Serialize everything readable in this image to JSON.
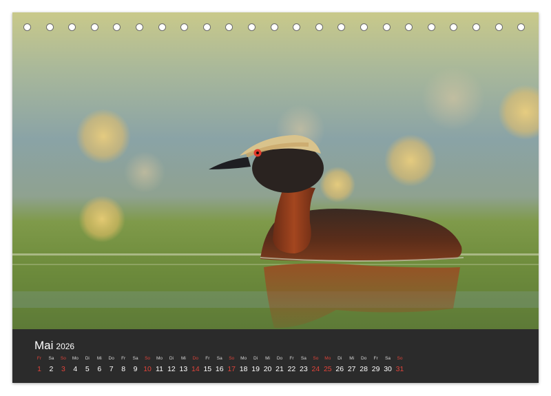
{
  "calendar": {
    "month": "Mai",
    "year": "2026",
    "days": [
      {
        "wd": "Fr",
        "n": "1",
        "red": true
      },
      {
        "wd": "Sa",
        "n": "2",
        "red": false
      },
      {
        "wd": "So",
        "n": "3",
        "red": true
      },
      {
        "wd": "Mo",
        "n": "4",
        "red": false
      },
      {
        "wd": "Di",
        "n": "5",
        "red": false
      },
      {
        "wd": "Mi",
        "n": "6",
        "red": false
      },
      {
        "wd": "Do",
        "n": "7",
        "red": false
      },
      {
        "wd": "Fr",
        "n": "8",
        "red": false
      },
      {
        "wd": "Sa",
        "n": "9",
        "red": false
      },
      {
        "wd": "So",
        "n": "10",
        "red": true
      },
      {
        "wd": "Mo",
        "n": "11",
        "red": false
      },
      {
        "wd": "Di",
        "n": "12",
        "red": false
      },
      {
        "wd": "Mi",
        "n": "13",
        "red": false
      },
      {
        "wd": "Do",
        "n": "14",
        "red": true
      },
      {
        "wd": "Fr",
        "n": "15",
        "red": false
      },
      {
        "wd": "Sa",
        "n": "16",
        "red": false
      },
      {
        "wd": "So",
        "n": "17",
        "red": true
      },
      {
        "wd": "Mo",
        "n": "18",
        "red": false
      },
      {
        "wd": "Di",
        "n": "19",
        "red": false
      },
      {
        "wd": "Mi",
        "n": "20",
        "red": false
      },
      {
        "wd": "Do",
        "n": "21",
        "red": false
      },
      {
        "wd": "Fr",
        "n": "22",
        "red": false
      },
      {
        "wd": "Sa",
        "n": "23",
        "red": false
      },
      {
        "wd": "So",
        "n": "24",
        "red": true
      },
      {
        "wd": "Mo",
        "n": "25",
        "red": true
      },
      {
        "wd": "Di",
        "n": "26",
        "red": false
      },
      {
        "wd": "Mi",
        "n": "27",
        "red": false
      },
      {
        "wd": "Do",
        "n": "28",
        "red": false
      },
      {
        "wd": "Fr",
        "n": "29",
        "red": false
      },
      {
        "wd": "Sa",
        "n": "30",
        "red": false
      },
      {
        "wd": "So",
        "n": "31",
        "red": true
      }
    ]
  },
  "colors": {
    "holiday_red": "#e0443a",
    "calendar_band": "#2b2b2b"
  },
  "binding_holes": 23
}
